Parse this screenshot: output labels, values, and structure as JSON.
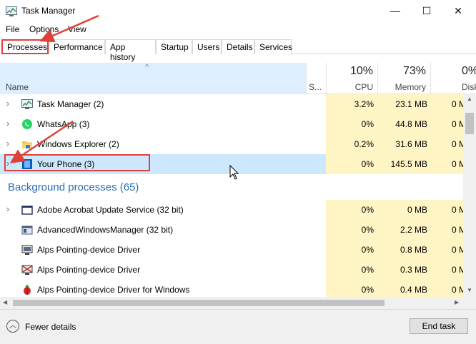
{
  "window": {
    "title": "Task Manager",
    "min_glyph": "—",
    "max_glyph": "☐",
    "close_glyph": "✕"
  },
  "menu": [
    "File",
    "Options",
    "View"
  ],
  "tabs": [
    "Processes",
    "Performance",
    "App history",
    "Startup",
    "Users",
    "Details",
    "Services"
  ],
  "active_tab": "Processes",
  "columns": {
    "name": "Name",
    "status": "S...",
    "cpu_pct": "10%",
    "cpu": "CPU",
    "memory_pct": "73%",
    "memory": "Memory",
    "disk_pct": "0%",
    "disk": "Disk",
    "sort_glyph": "^"
  },
  "apps": [
    {
      "name": "Task Manager (2)",
      "cpu": "3.2%",
      "memory": "23.1 MB",
      "disk": "0 M",
      "icon": "task-manager-icon"
    },
    {
      "name": "WhatsApp (3)",
      "cpu": "0%",
      "memory": "44.8 MB",
      "disk": "0 M",
      "icon": "whatsapp-icon"
    },
    {
      "name": "Windows Explorer (2)",
      "cpu": "0.2%",
      "memory": "31.6 MB",
      "disk": "0 M",
      "icon": "folder-icon"
    },
    {
      "name": "Your Phone (3)",
      "cpu": "0%",
      "memory": "145.5 MB",
      "disk": "0 M",
      "icon": "your-phone-icon"
    }
  ],
  "background_title": "Background processes (65)",
  "background": [
    {
      "name": "Adobe Acrobat Update Service (32 bit)",
      "cpu": "0%",
      "memory": "0 MB",
      "disk": "0 M",
      "icon": "window-icon"
    },
    {
      "name": "AdvancedWindowsManager (32 bit)",
      "cpu": "0%",
      "memory": "2.2 MB",
      "disk": "0 M",
      "icon": "app-window-icon"
    },
    {
      "name": "Alps Pointing-device Driver",
      "cpu": "0%",
      "memory": "0.8 MB",
      "disk": "0 M",
      "icon": "monitor-icon"
    },
    {
      "name": "Alps Pointing-device Driver",
      "cpu": "0%",
      "memory": "0.3 MB",
      "disk": "0 M",
      "icon": "monitor-cross-icon"
    },
    {
      "name": "Alps Pointing-device Driver for Windows",
      "cpu": "0%",
      "memory": "0.4 MB",
      "disk": "0 M",
      "icon": "bug-icon"
    }
  ],
  "footer": {
    "fewer_details": "Fewer details",
    "end_task": "End task"
  },
  "colors": {
    "accent_red": "#e0403a",
    "heat_yellow": "#fff4c4",
    "selection_blue": "#cce8ff",
    "group_blue": "#2a6fb5"
  }
}
